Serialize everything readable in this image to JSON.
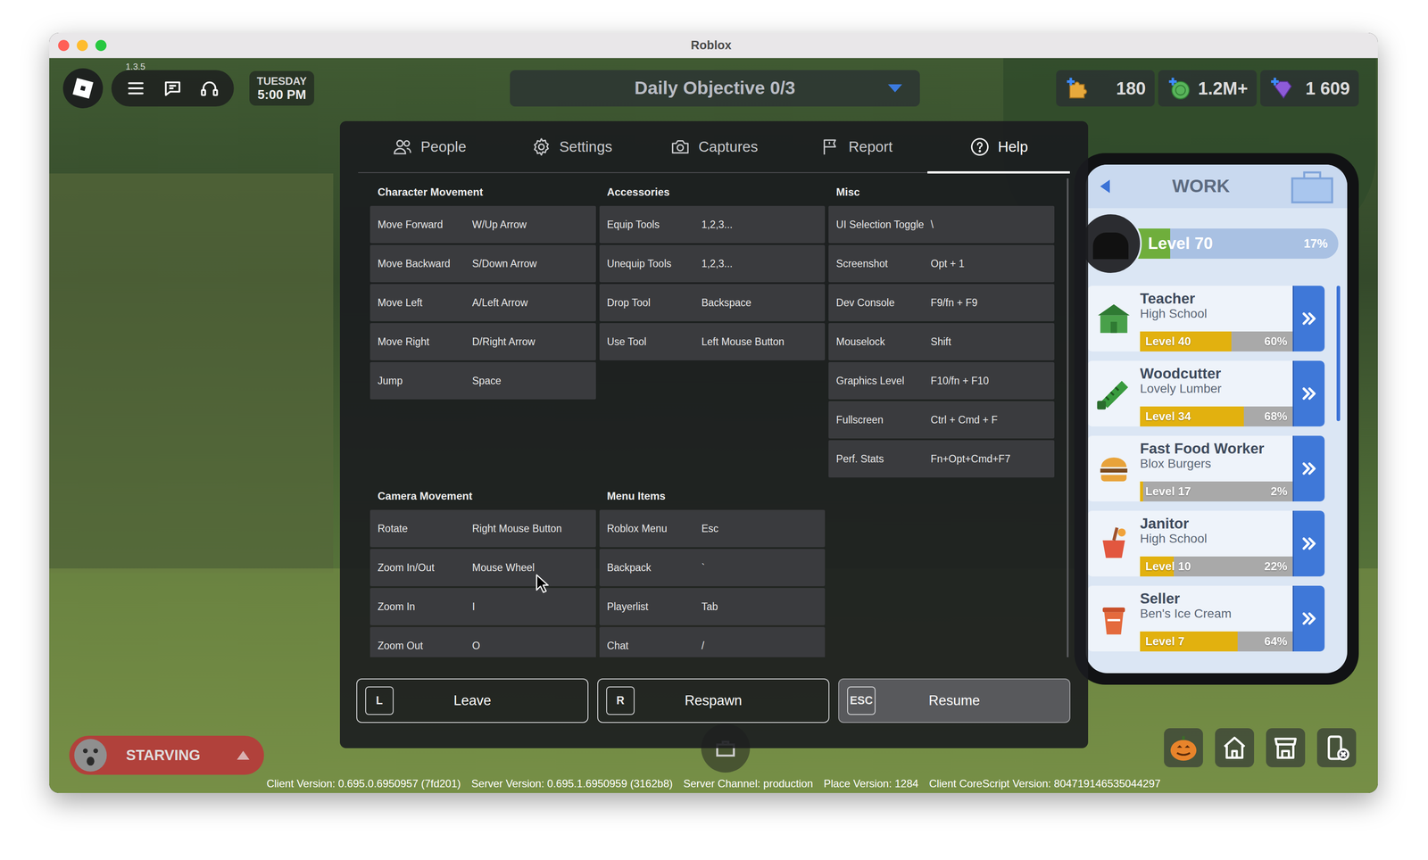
{
  "window": {
    "title": "Roblox"
  },
  "hud": {
    "version_tag": "1.3.5",
    "day": "TUESDAY",
    "time": "5:00 PM",
    "objective": "Daily Objective 0/3",
    "currencies": [
      {
        "value": "180"
      },
      {
        "value": "1.2M+"
      },
      {
        "value": "1 609"
      }
    ],
    "hunger": {
      "label": "STARVING"
    }
  },
  "menu": {
    "tabs": [
      {
        "label": "People",
        "selected": false
      },
      {
        "label": "Settings",
        "selected": false
      },
      {
        "label": "Captures",
        "selected": false
      },
      {
        "label": "Report",
        "selected": false
      },
      {
        "label": "Help",
        "selected": true
      }
    ],
    "help": {
      "groups": [
        {
          "sections": [
            {
              "title": "Character Movement",
              "bindings": [
                {
                  "action": "Move Forward",
                  "keys": "W/Up Arrow"
                },
                {
                  "action": "Move Backward",
                  "keys": "S/Down Arrow"
                },
                {
                  "action": "Move Left",
                  "keys": "A/Left Arrow"
                },
                {
                  "action": "Move Right",
                  "keys": "D/Right Arrow"
                },
                {
                  "action": "Jump",
                  "keys": "Space"
                }
              ]
            },
            {
              "title": "Accessories",
              "bindings": [
                {
                  "action": "Equip Tools",
                  "keys": "1,2,3..."
                },
                {
                  "action": "Unequip Tools",
                  "keys": "1,2,3..."
                },
                {
                  "action": "Drop Tool",
                  "keys": "Backspace"
                },
                {
                  "action": "Use Tool",
                  "keys": "Left Mouse Button"
                }
              ]
            },
            {
              "title": "Misc",
              "bindings": [
                {
                  "action": "UI Selection Toggle",
                  "keys": "\\"
                },
                {
                  "action": "Screenshot",
                  "keys": "Opt + 1"
                },
                {
                  "action": "Dev Console",
                  "keys": "F9/fn + F9"
                },
                {
                  "action": "Mouselock",
                  "keys": "Shift"
                },
                {
                  "action": "Graphics Level",
                  "keys": "F10/fn + F10"
                },
                {
                  "action": "Fullscreen",
                  "keys": "Ctrl + Cmd + F"
                },
                {
                  "action": "Perf. Stats",
                  "keys": "Fn+Opt+Cmd+F7"
                }
              ]
            }
          ]
        },
        {
          "sections": [
            {
              "title": "Camera Movement",
              "bindings": [
                {
                  "action": "Rotate",
                  "keys": "Right Mouse Button"
                },
                {
                  "action": "Zoom In/Out",
                  "keys": "Mouse Wheel"
                },
                {
                  "action": "Zoom In",
                  "keys": "I"
                },
                {
                  "action": "Zoom Out",
                  "keys": "O"
                }
              ]
            },
            {
              "title": "Menu Items",
              "bindings": [
                {
                  "action": "Roblox Menu",
                  "keys": "Esc"
                },
                {
                  "action": "Backpack",
                  "keys": "`"
                },
                {
                  "action": "Playerlist",
                  "keys": "Tab"
                },
                {
                  "action": "Chat",
                  "keys": "/"
                }
              ]
            }
          ]
        }
      ]
    },
    "buttons": [
      {
        "key": "L",
        "label": "Leave",
        "highlighted": false
      },
      {
        "key": "R",
        "label": "Respawn",
        "highlighted": false
      },
      {
        "key": "ESC",
        "label": "Resume",
        "highlighted": true
      }
    ]
  },
  "work_app": {
    "title": "WORK",
    "level_label": "Level 70",
    "percent": "17%",
    "level": 0.17,
    "jobs": [
      {
        "title": "Teacher",
        "place": "High School",
        "level_label": "Level 40",
        "percent": "60%",
        "level": 0.6
      },
      {
        "title": "Woodcutter",
        "place": "Lovely Lumber",
        "level_label": "Level 34",
        "percent": "68%",
        "level": 0.68
      },
      {
        "title": "Fast Food Worker",
        "place": "Blox Burgers",
        "level_label": "Level 17",
        "percent": "2%",
        "level": 0.02
      },
      {
        "title": "Janitor",
        "place": "High School",
        "level_label": "Level 10",
        "percent": "22%",
        "level": 0.22
      },
      {
        "title": "Seller",
        "place": "Ben's Ice Cream",
        "level_label": "Level 7",
        "percent": "64%",
        "level": 0.64
      }
    ]
  },
  "status_bar": [
    "Client Version: 0.695.0.6950957 (7fd201)",
    "Server Version: 0.695.1.6950959 (3162b8)",
    "Server Channel: production",
    "Place Version: 1284",
    "Client CoreScript Version: 804719146535044297"
  ]
}
